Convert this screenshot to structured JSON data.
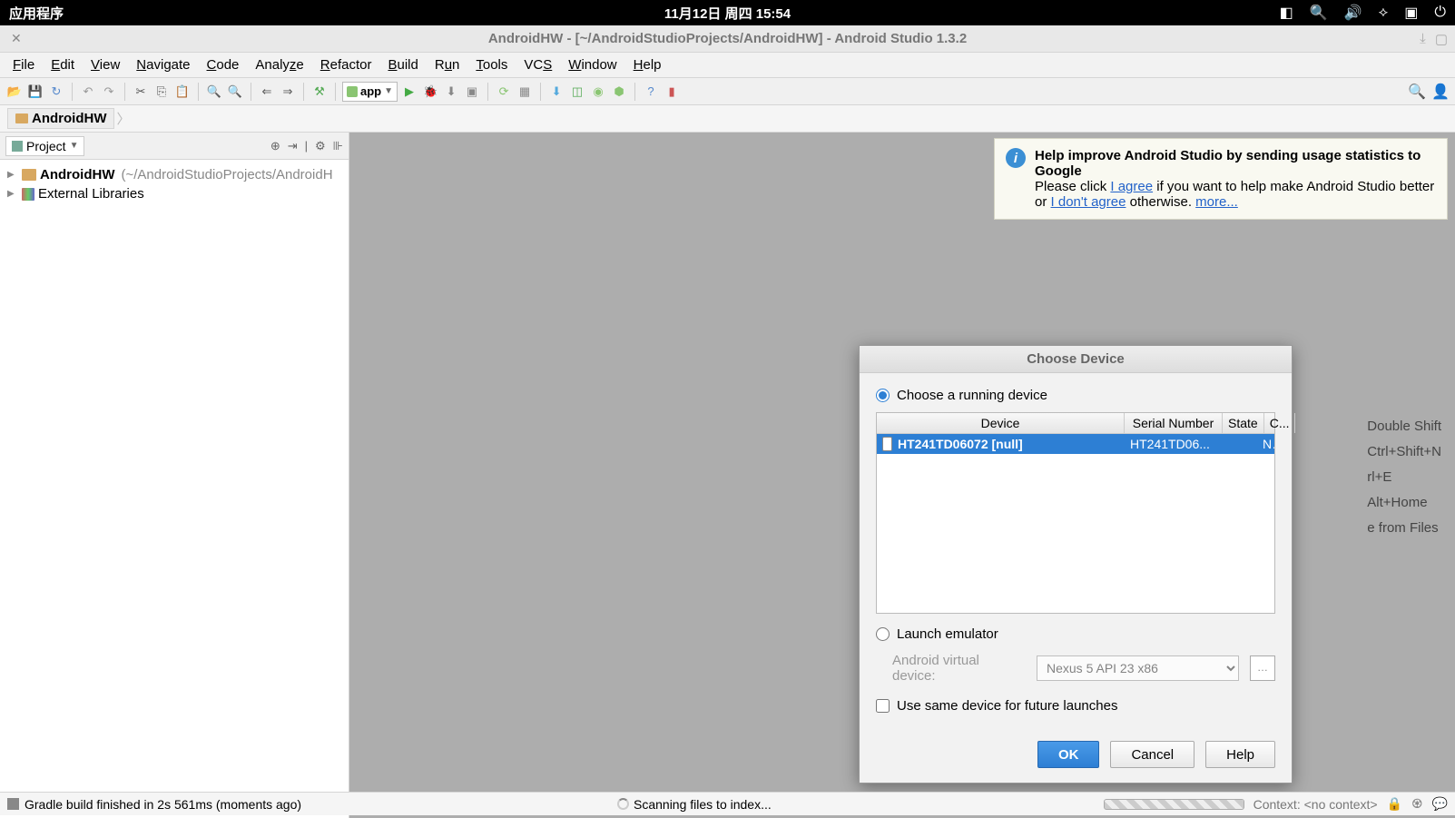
{
  "os_bar": {
    "apps_label": "应用程序",
    "datetime": "11月12日 周四  15:54"
  },
  "window": {
    "title": "AndroidHW - [~/AndroidStudioProjects/AndroidHW] - Android Studio 1.3.2"
  },
  "menu": {
    "file": "File",
    "edit": "Edit",
    "view": "View",
    "navigate": "Navigate",
    "code": "Code",
    "analyze": "Analyze",
    "refactor": "Refactor",
    "build": "Build",
    "run": "Run",
    "tools": "Tools",
    "vcs": "VCS",
    "window": "Window",
    "help": "Help"
  },
  "toolbar": {
    "app_combo": "app"
  },
  "breadcrumb": {
    "root": "AndroidHW"
  },
  "sidebar": {
    "header_label": "Project",
    "rows": [
      {
        "name": "AndroidHW",
        "path": "(~/AndroidStudioProjects/AndroidH"
      },
      {
        "name": "External Libraries",
        "path": ""
      }
    ]
  },
  "tip": {
    "title": "Help improve Android Studio by sending usage statistics to Google",
    "prefix": "Please click ",
    "agree": "I agree",
    "mid": " if you want to help make Android Studio better or ",
    "disagree": "I don't agree",
    "suffix": " otherwise. ",
    "more": "more..."
  },
  "hints": {
    "h1": "Double Shift",
    "h2": "Ctrl+Shift+N",
    "h3": "rl+E",
    "h4": "Alt+Home",
    "h5": "e from Files"
  },
  "dialog": {
    "title": "Choose Device",
    "choose_running": "Choose a running device",
    "table": {
      "cols": {
        "device": "Device",
        "serial": "Serial Number",
        "state": "State",
        "compat": "C..."
      },
      "row": {
        "device": "HT241TD06072 [null]",
        "serial": "HT241TD06...",
        "state": "",
        "compat": "No"
      }
    },
    "launch_emulator": "Launch emulator",
    "avd_label": "Android virtual device:",
    "avd_value": "Nexus 5 API 23 x86",
    "same_device": "Use same device for future launches",
    "buttons": {
      "ok": "OK",
      "cancel": "Cancel",
      "help": "Help"
    }
  },
  "status": {
    "left": "Gradle build finished in 2s 561ms (moments ago)",
    "center": "Scanning files to index...",
    "context": "Context: <no context>"
  }
}
